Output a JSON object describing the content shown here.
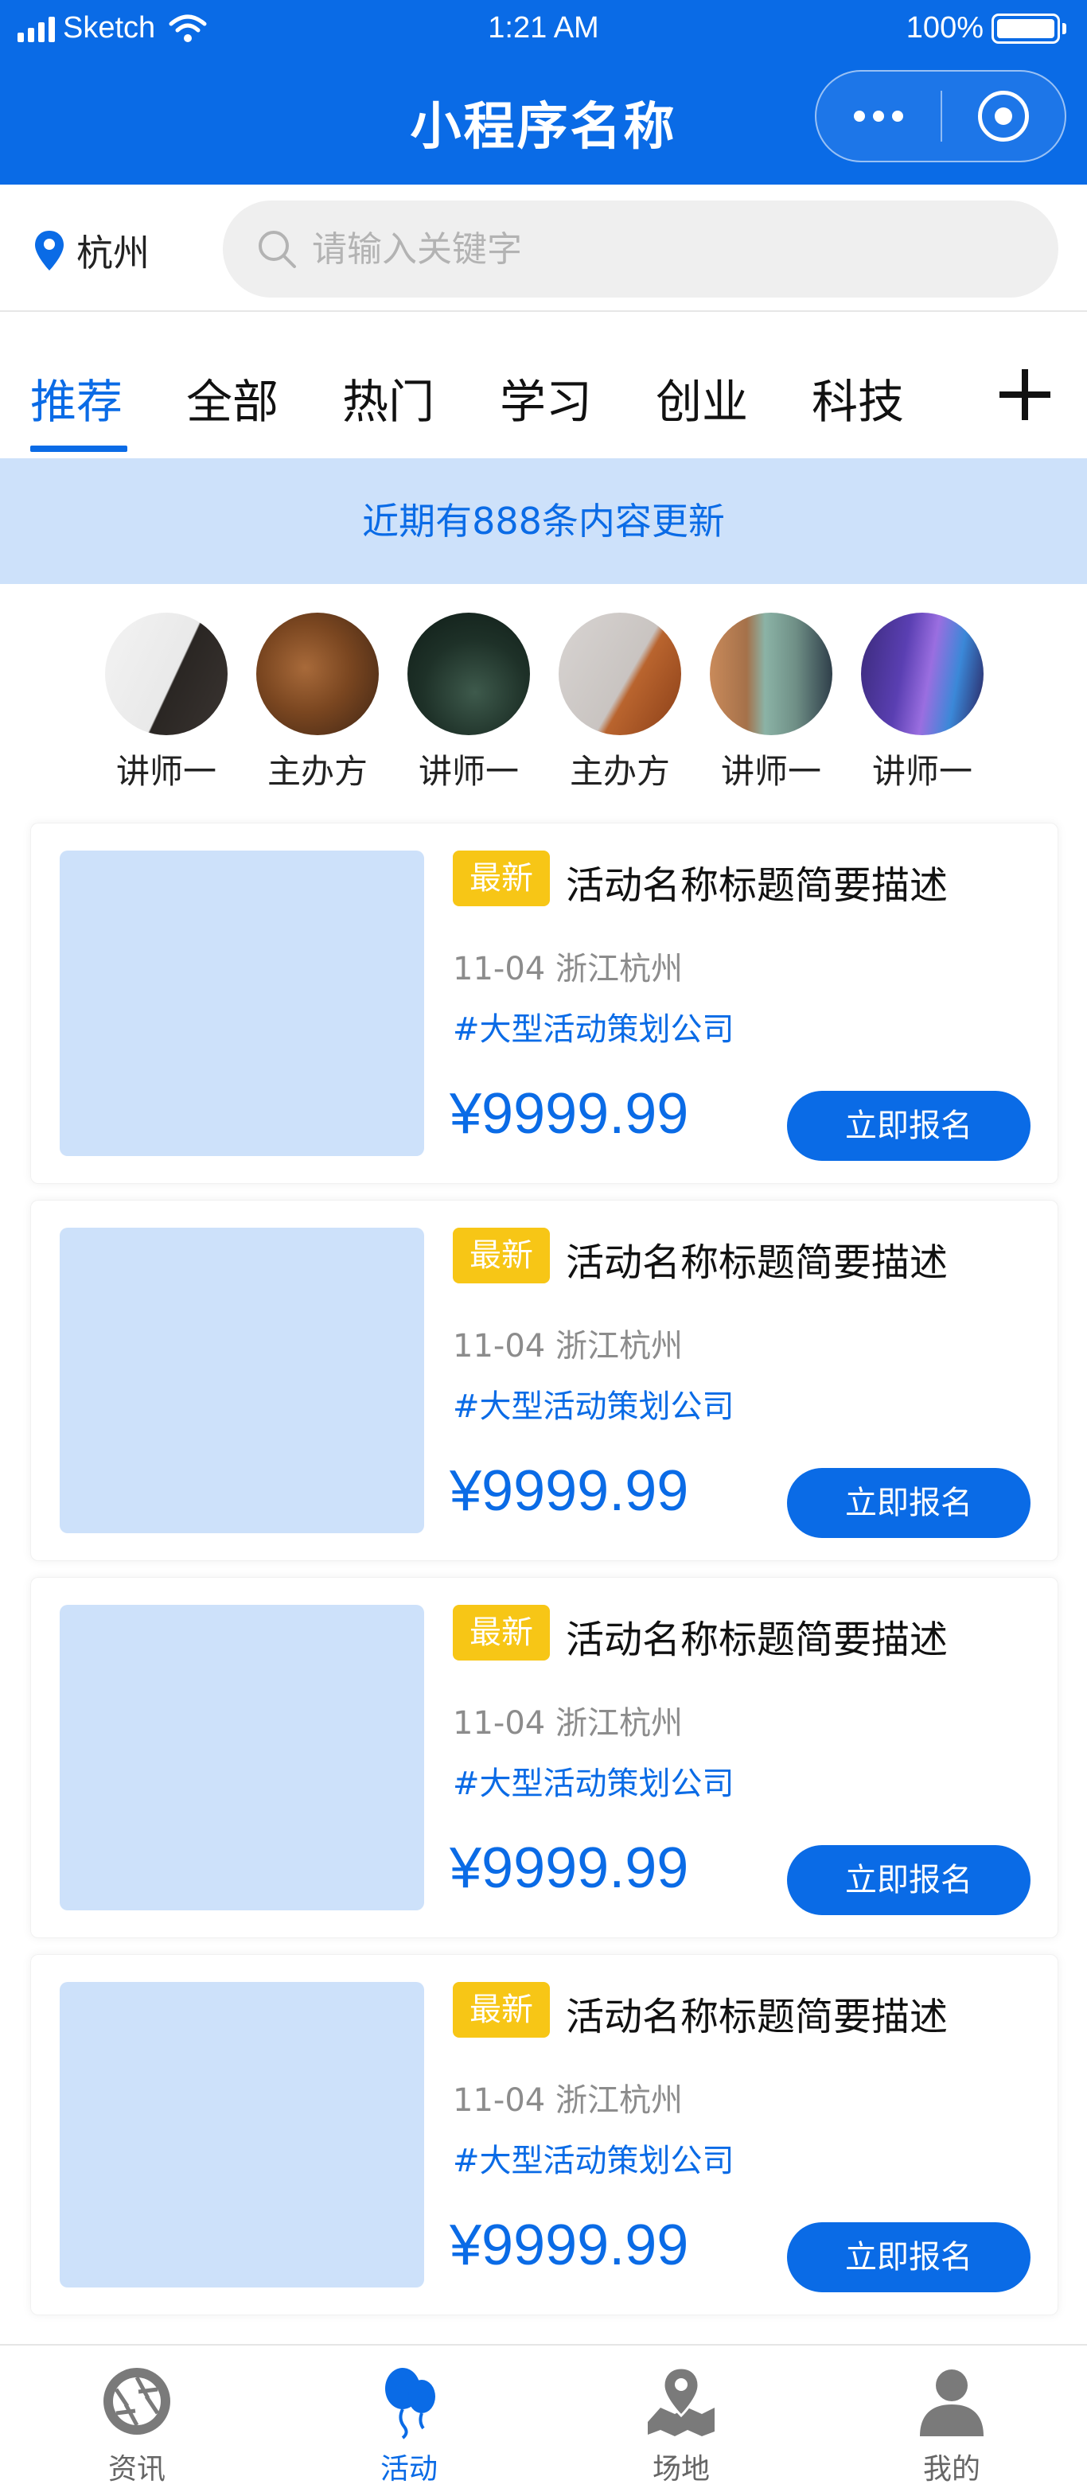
{
  "status_bar": {
    "carrier": "Sketch",
    "time": "1:21 AM",
    "battery": "100%"
  },
  "header": {
    "title": "小程序名称"
  },
  "location": {
    "city": "杭州"
  },
  "search": {
    "placeholder": "请输入关键字"
  },
  "tabs": [
    {
      "label": "推荐",
      "active": true
    },
    {
      "label": "全部",
      "active": false
    },
    {
      "label": "热门",
      "active": false
    },
    {
      "label": "学习",
      "active": false
    },
    {
      "label": "创业",
      "active": false
    },
    {
      "label": "科技",
      "active": false
    }
  ],
  "notice": {
    "text": "近期有888条内容更新"
  },
  "avatars": [
    {
      "name": "讲师一"
    },
    {
      "name": "主办方"
    },
    {
      "name": "讲师一"
    },
    {
      "name": "主办方"
    },
    {
      "name": "讲师一"
    },
    {
      "name": "讲师一"
    }
  ],
  "events": [
    {
      "badge": "最新",
      "title": "活动名称标题简要描述",
      "meta": "11-04 浙江杭州",
      "tag": "#大型活动策划公司",
      "price": "¥9999.99",
      "button": "立即报名"
    },
    {
      "badge": "最新",
      "title": "活动名称标题简要描述",
      "meta": "11-04 浙江杭州",
      "tag": "#大型活动策划公司",
      "price": "¥9999.99",
      "button": "立即报名"
    },
    {
      "badge": "最新",
      "title": "活动名称标题简要描述",
      "meta": "11-04 浙江杭州",
      "tag": "#大型活动策划公司",
      "price": "¥9999.99",
      "button": "立即报名"
    },
    {
      "badge": "最新",
      "title": "活动名称标题简要描述",
      "meta": "11-04 浙江杭州",
      "tag": "#大型活动策划公司",
      "price": "¥9999.99",
      "button": "立即报名"
    }
  ],
  "bottom_nav": [
    {
      "label": "资讯",
      "icon": "aperture-icon",
      "active": false
    },
    {
      "label": "活动",
      "icon": "balloons-icon",
      "active": true
    },
    {
      "label": "场地",
      "icon": "map-pin-icon",
      "active": false
    },
    {
      "label": "我的",
      "icon": "user-icon",
      "active": false
    }
  ],
  "colors": {
    "brand": "#0a6be6",
    "notice_bg": "#cde1fa",
    "badge": "#f7c616",
    "placeholder": "#cde1fa"
  }
}
